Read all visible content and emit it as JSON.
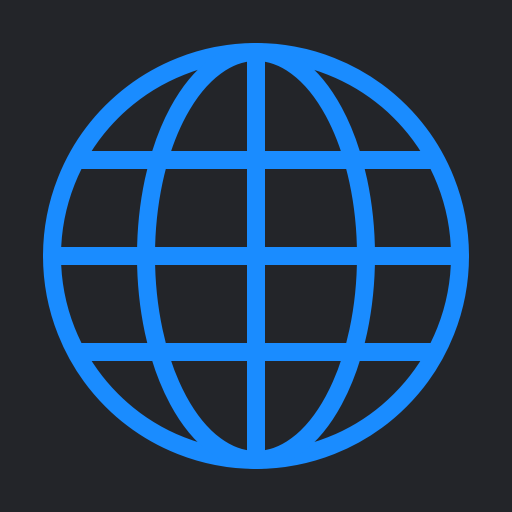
{
  "app_icon": {
    "icon": "globe-icon",
    "background_color": "#232529",
    "accent_color": "#1A8CFF"
  }
}
